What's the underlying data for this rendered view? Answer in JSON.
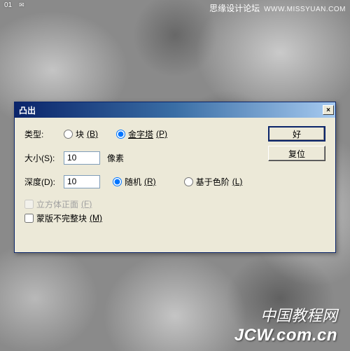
{
  "top_bar": {
    "tab": "01",
    "icon": "✉"
  },
  "watermark_top": {
    "text": "思缘设计论坛",
    "url": "WWW.MISSYUAN.COM"
  },
  "watermark_bottom": {
    "cn": "中国教程网",
    "url": "JCW.com.cn"
  },
  "dialog": {
    "title": "凸出",
    "close": "×",
    "labels": {
      "type": "类型:",
      "size": "大小(S):",
      "depth": "深度(D):",
      "unit": "像素"
    },
    "type_options": {
      "block": {
        "label": "块",
        "hotkey": "(B)"
      },
      "pyramid": {
        "label": "金字塔",
        "hotkey": "(P)"
      }
    },
    "size_value": "10",
    "depth_value": "10",
    "depth_options": {
      "random": {
        "label": "随机",
        "hotkey": "(R)"
      },
      "levels": {
        "label": "基于色阶",
        "hotkey": "(L)"
      }
    },
    "checkboxes": {
      "front": {
        "label": "立方体正面",
        "hotkey": "(F)"
      },
      "mask": {
        "label": "蒙版不完整块",
        "hotkey": "(M)"
      }
    },
    "buttons": {
      "ok": "好",
      "reset": "复位"
    }
  }
}
